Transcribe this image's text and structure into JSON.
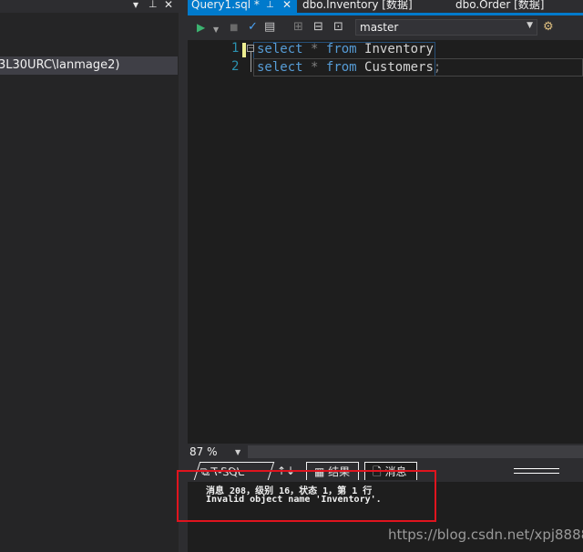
{
  "left_panel": {
    "header_icons": [
      "chevron-down-icon",
      "pin-icon",
      "close-icon"
    ],
    "tree_item": "3L30URC\\lanmage2)"
  },
  "doc_tabs": [
    {
      "label": "Query1.sql *",
      "active": true
    },
    {
      "label": "dbo.Inventory [数据]",
      "active": false
    },
    {
      "label": "dbo.Order [数据]",
      "active": false
    }
  ],
  "tab_icons": {
    "pin": "pin-icon",
    "close": "✕"
  },
  "toolbar": {
    "database": "master",
    "icons": [
      "execute-icon",
      "dropdown-icon",
      "stop-icon",
      "parse-check-icon",
      "query-plan-icon",
      "connect-icon",
      "change-connection-icon",
      "disconnect-icon",
      "available-databases-icon"
    ]
  },
  "editor": {
    "lines": [
      {
        "number": "1",
        "keyword1": "select",
        "op": "*",
        "keyword2": "from",
        "table": "Inventory",
        "end": ""
      },
      {
        "number": "2",
        "keyword1": "select",
        "op": "*",
        "keyword2": "from",
        "table": "Customers",
        "end": ";"
      }
    ]
  },
  "zoom": "87 %",
  "result_tabs": {
    "tsql": "T-SQL",
    "sort": "↑↓",
    "results": "结果",
    "messages": "消息"
  },
  "messages": [
    "消息 208，级别 16，状态 1，第 1 行",
    "Invalid object name 'Inventory'."
  ],
  "watermark": "https://blog.csdn.net/xpj8888",
  "colors": {
    "accent": "#007acc",
    "keyword": "#569cd6",
    "annotation_box": "#e0141e",
    "background": "#1e1e1e"
  }
}
